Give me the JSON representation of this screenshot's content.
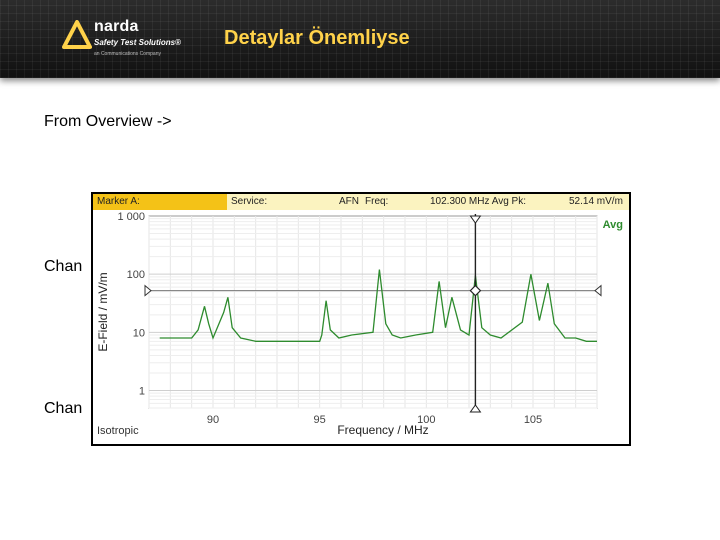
{
  "header": {
    "logo": {
      "name": "narda",
      "tagline": "Safety Test Solutions®",
      "subline": "an  Communications Company"
    },
    "title": "Detaylar Önemliyse"
  },
  "content": {
    "line1": "From Overview ->",
    "line2": "Chan",
    "line3": "Chan"
  },
  "status_bar": {
    "marker": "Marker A:",
    "service": "Service:",
    "service_value": "AFN",
    "freq_label": "Freq:",
    "freq_value": "102.300 MHz Avg Pk:",
    "level": "52.14 mV/m"
  },
  "chart_data": {
    "type": "line",
    "title": "",
    "xlabel": "Frequency / MHz",
    "ylabel": "E-Field / mV/m",
    "series": [
      {
        "name": "Avg",
        "color": "#2e8b2e",
        "x": [
          87.5,
          88.2,
          89.0,
          89.3,
          89.6,
          89.8,
          90.0,
          90.5,
          90.7,
          90.9,
          91.3,
          92.0,
          93.0,
          94.0,
          95.0,
          95.1,
          95.3,
          95.5,
          95.9,
          96.5,
          97.5,
          97.8,
          98.1,
          98.4,
          98.8,
          99.5,
          100.3,
          100.6,
          100.9,
          101.2,
          101.6,
          102.0,
          102.3,
          102.6,
          103.0,
          103.5,
          104.5,
          104.9,
          105.3,
          105.7,
          106.0,
          106.5,
          107.0,
          107.5,
          108.0
        ],
        "y": [
          8,
          8,
          8,
          11,
          28,
          14,
          8,
          22,
          40,
          12,
          8,
          7,
          7,
          7,
          7,
          9,
          35,
          11,
          8,
          9,
          10,
          120,
          14,
          9,
          8,
          9,
          10,
          75,
          12,
          40,
          11,
          9,
          95,
          12,
          9,
          8,
          15,
          100,
          16,
          70,
          14,
          8,
          8,
          7,
          7
        ]
      }
    ],
    "xlim": [
      87,
      108
    ],
    "ylim": [
      0.5,
      1000
    ],
    "yscale": "log",
    "xticks": [
      "90",
      "95",
      "100",
      "105"
    ],
    "yticks": [
      "1 000",
      "100",
      "10",
      "1"
    ],
    "marker": {
      "x": 102.3,
      "y": 52.14
    },
    "reference_level": 52.14,
    "annotations": [
      "Isotropic",
      "Avg"
    ],
    "grid": true,
    "legend": "top-right"
  }
}
